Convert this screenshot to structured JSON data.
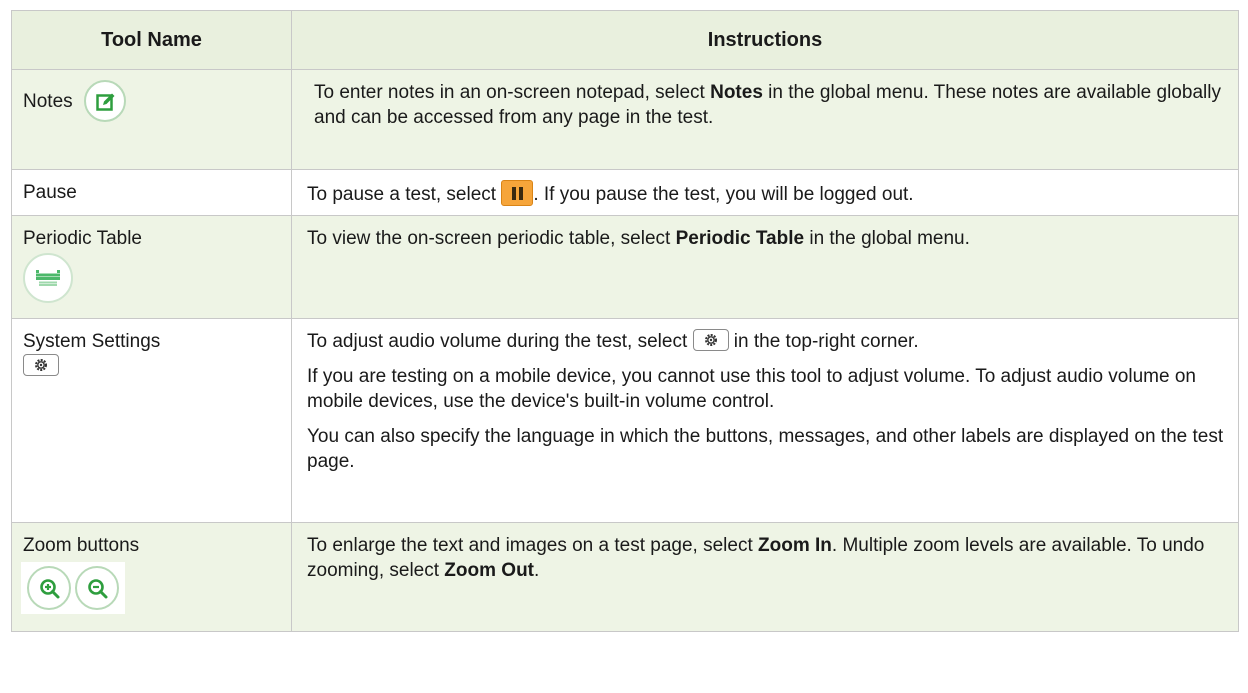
{
  "table": {
    "header": {
      "tool": "Tool Name",
      "instructions": "Instructions"
    },
    "rows": [
      {
        "tool": "Notes",
        "icon": "notes-icon",
        "instructions": [
          {
            "pre": "To enter notes in an on-screen notepad, select ",
            "bold": "Notes",
            "post": " in the global menu. These notes are available globally and can be accessed from any page in the test."
          }
        ]
      },
      {
        "tool": "Pause",
        "icon": "pause-icon",
        "instructions": [
          {
            "pre": "To pause a test, select ",
            "post": ". If you pause the test, you will be logged out."
          }
        ]
      },
      {
        "tool": "Periodic Table",
        "icon": "periodic-table-icon",
        "instructions": [
          {
            "pre": "To view the on-screen periodic table, select ",
            "bold": "Periodic Table",
            "post": " in the global menu."
          }
        ]
      },
      {
        "tool": "System Settings",
        "icon": "gear-icon",
        "instructions": [
          {
            "pre": "To adjust audio volume during the test, select ",
            "post": " in the top-right corner."
          },
          {
            "text": "If you are testing on a mobile device, you cannot use this tool to adjust volume. To adjust audio volume on mobile devices, use the device's built-in volume control."
          },
          {
            "text": "You can also specify the language in which the buttons, messages, and other labels are displayed on the test page."
          }
        ]
      },
      {
        "tool": "Zoom buttons",
        "icon": "zoom-icons",
        "instructions": [
          {
            "pre": "To enlarge the text and images on a test page, select ",
            "bold": "Zoom In",
            "mid": ". Multiple zoom levels are available. To undo zooming, select ",
            "bold2": "Zoom Out",
            "post": "."
          }
        ]
      }
    ]
  },
  "colors": {
    "header_bg": "#e9f0de",
    "alt_row_bg": "#eef4e5",
    "icon_green": "#2e9e3e",
    "pause_orange": "#f6a53a"
  }
}
